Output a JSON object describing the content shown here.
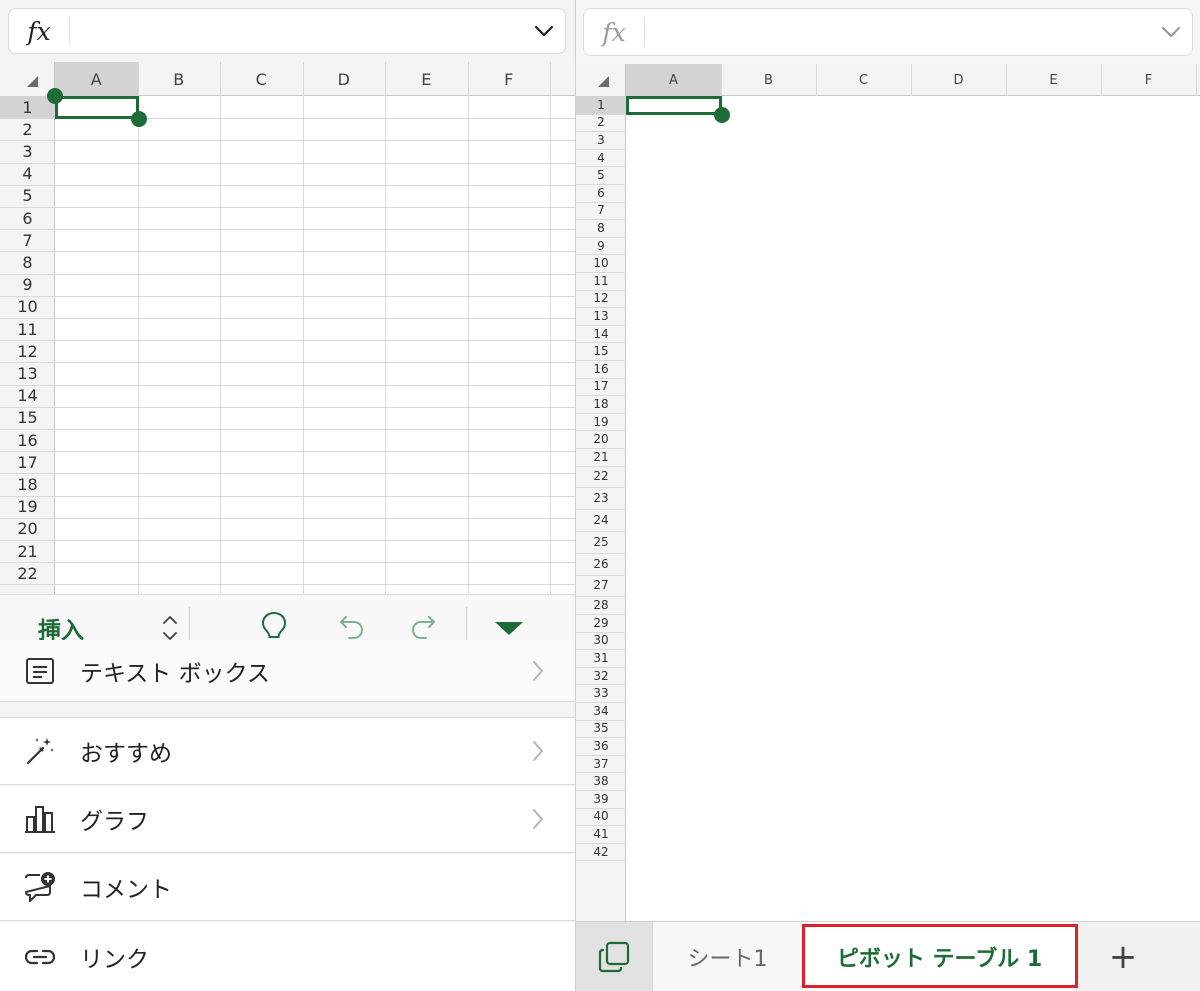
{
  "left": {
    "formula_bar": {
      "fx_label": "fx",
      "value": ""
    },
    "columns": [
      "A",
      "B",
      "C",
      "D",
      "E",
      "F"
    ],
    "rows": [
      "1",
      "2",
      "3",
      "4",
      "5",
      "6",
      "7",
      "8",
      "9",
      "10",
      "11",
      "12",
      "13",
      "14",
      "15",
      "16",
      "17",
      "18",
      "19",
      "20",
      "21",
      "22"
    ],
    "selected_cell": "A1",
    "toolbar": {
      "tab_label": "挿入",
      "icons": [
        "chevron-up-down-icon",
        "lightbulb-icon",
        "undo-icon",
        "redo-icon",
        "collapse-triangle-icon"
      ]
    },
    "menu": [
      {
        "label": "テキスト ボックス",
        "icon": "text-box-icon"
      },
      {
        "label": "おすすめ",
        "icon": "magic-wand-icon"
      },
      {
        "label": "グラフ",
        "icon": "bar-chart-icon"
      },
      {
        "label": "コメント",
        "icon": "comment-add-icon"
      },
      {
        "label": "リンク",
        "icon": "link-icon"
      }
    ]
  },
  "right": {
    "formula_bar": {
      "fx_label": "fx",
      "value": ""
    },
    "columns": [
      "A",
      "B",
      "C",
      "D",
      "E",
      "F"
    ],
    "rows": [
      "1",
      "2",
      "3",
      "4",
      "5",
      "6",
      "7",
      "8",
      "9",
      "10",
      "11",
      "12",
      "13",
      "14",
      "15",
      "16",
      "17",
      "18",
      "19",
      "20",
      "21",
      "22",
      "23",
      "24",
      "25",
      "26",
      "27",
      "28",
      "29",
      "30",
      "31",
      "32",
      "33",
      "34",
      "35",
      "36",
      "37",
      "38",
      "39",
      "40",
      "41",
      "42"
    ],
    "selected_cell": "A1",
    "sheet_tabs": [
      {
        "label": "シート1",
        "active": false
      },
      {
        "label": "ピボット テーブル 1",
        "active": true
      }
    ],
    "add_sheet_label": "+"
  },
  "colors": {
    "accent": "#1d6b36",
    "highlight": "#e0202a",
    "grid_line": "#d9d9d9",
    "header_selected": "#d3d3d3"
  }
}
